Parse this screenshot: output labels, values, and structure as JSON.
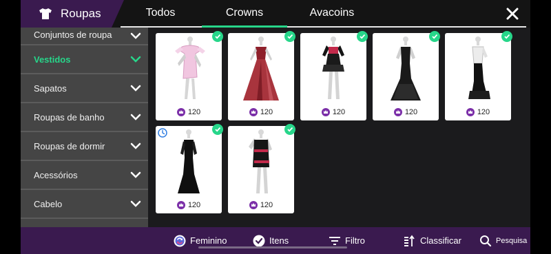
{
  "header": {
    "title": "Roupas",
    "tabs": [
      {
        "label": "Todos"
      },
      {
        "label": "Crowns"
      },
      {
        "label": "Avacoins"
      }
    ],
    "active_tab": "Crowns"
  },
  "sidebar": {
    "items": [
      {
        "label": "Conjuntos de roupa"
      },
      {
        "label": "Vestidos"
      },
      {
        "label": "Sapatos"
      },
      {
        "label": "Roupas de banho"
      },
      {
        "label": "Roupas de dormir"
      },
      {
        "label": "Acessórios"
      },
      {
        "label": "Cabelo"
      }
    ],
    "active": "Vestidos"
  },
  "items": [
    {
      "price": "120",
      "owned": true,
      "outfit": "pink-mini-dress"
    },
    {
      "price": "120",
      "owned": true,
      "outfit": "red-ball-gown"
    },
    {
      "price": "120",
      "owned": true,
      "outfit": "black-ruffle-mini"
    },
    {
      "price": "120",
      "owned": true,
      "outfit": "black-mermaid-gown"
    },
    {
      "price": "120",
      "owned": true,
      "outfit": "black-white-mermaid"
    },
    {
      "price": "120",
      "owned": true,
      "timed": true,
      "outfit": "black-lace-gown"
    },
    {
      "price": "120",
      "owned": true,
      "outfit": "jersey-88-dress"
    }
  ],
  "bottom_bar": {
    "gender": "Feminino",
    "items": "Itens",
    "filter": "Filtro",
    "sort": "Classificar",
    "search": "Pesquisa"
  },
  "colors": {
    "accent_green": "#27d68a",
    "purple": "#3a1a4f",
    "crown_purple": "#7b2fa8",
    "clock_blue": "#2f7de1"
  }
}
